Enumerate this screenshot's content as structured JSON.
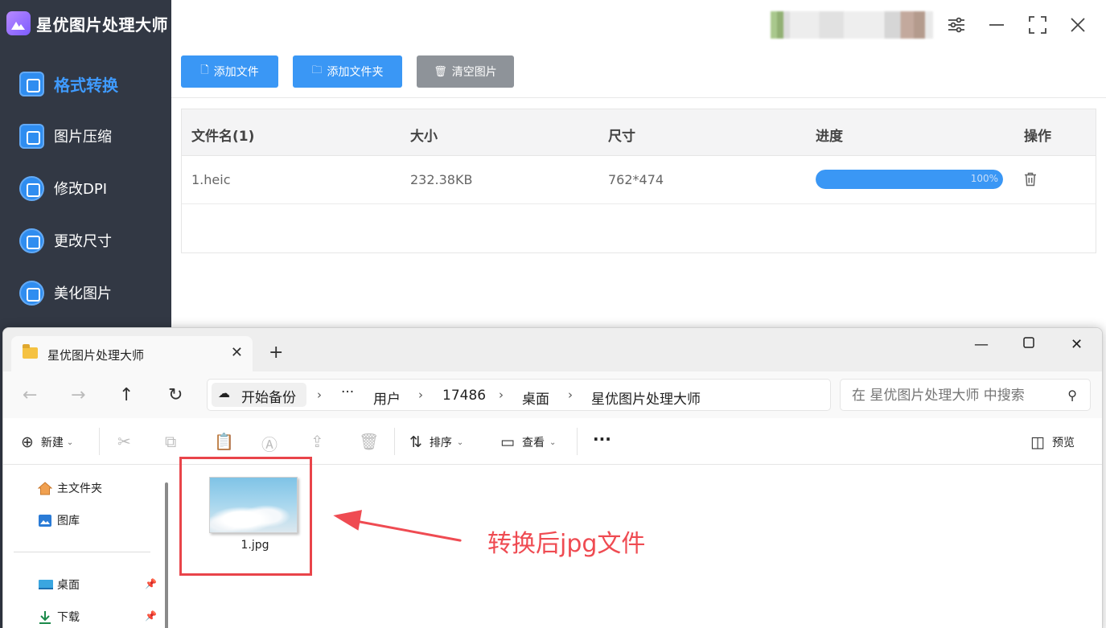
{
  "app": {
    "title": "星优图片处理大师",
    "nav": [
      {
        "label": "格式转换",
        "icon": "image-convert-icon",
        "active": true
      },
      {
        "label": "图片压缩",
        "icon": "image-compress-icon",
        "active": false
      },
      {
        "label": "修改DPI",
        "icon": "dpi-icon",
        "active": false
      },
      {
        "label": "更改尺寸",
        "icon": "resize-icon",
        "active": false
      },
      {
        "label": "美化图片",
        "icon": "beautify-icon",
        "active": false
      }
    ],
    "toolbar": {
      "add_file": "添加文件",
      "add_folder": "添加文件夹",
      "clear_images": "清空图片"
    },
    "table": {
      "headers": [
        "文件名(1)",
        "大小",
        "尺寸",
        "进度",
        "操作"
      ],
      "rows": [
        {
          "name": "1.heic",
          "size": "232.38KB",
          "dimensions": "762*474",
          "progress": 100,
          "progress_label": "100%"
        }
      ]
    },
    "colors": {
      "accent": "#3a97f5",
      "sidebar": "#323844",
      "active_nav": "#3f9bff"
    }
  },
  "explorer": {
    "tab_title": "星优图片处理大师",
    "breadcrumb": {
      "backup": "开始备份",
      "more": "···",
      "items": [
        "用户",
        "17486",
        "桌面",
        "星优图片处理大师"
      ]
    },
    "search_placeholder": "在 星优图片处理大师 中搜索",
    "commands": {
      "new": "新建",
      "sort": "排序",
      "view": "查看",
      "more": "···",
      "preview": "预览"
    },
    "nav_pane": {
      "home": "主文件夹",
      "gallery": "图库",
      "desktop": "桌面",
      "downloads": "下载"
    },
    "files": [
      {
        "name": "1.jpg"
      }
    ]
  },
  "annotation": {
    "text": "转换后jpg文件",
    "color": "#ef4b52"
  }
}
